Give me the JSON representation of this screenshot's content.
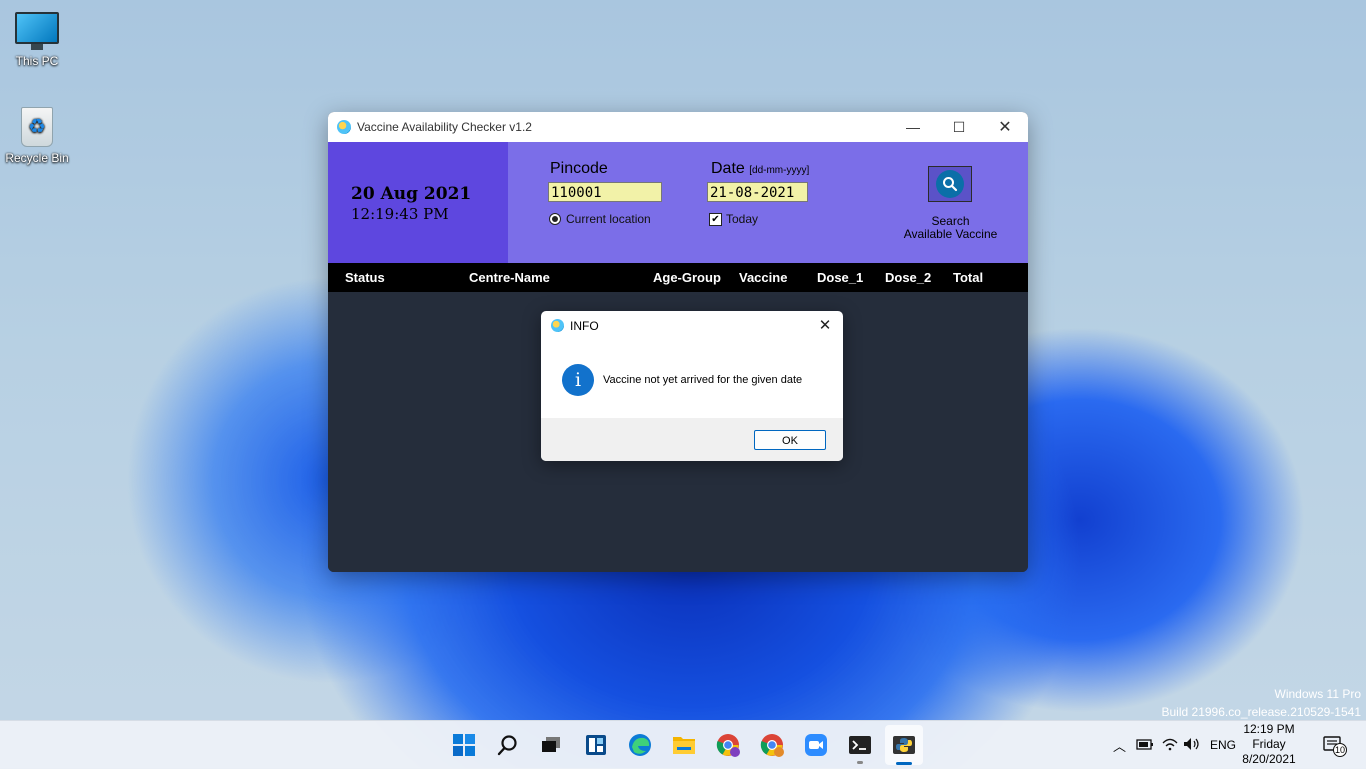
{
  "desktop": {
    "icons": [
      {
        "label": "This PC"
      },
      {
        "label": "Recycle Bin"
      }
    ],
    "watermark": {
      "edition": "Windows 11 Pro",
      "build": "Build 21996.co_release.210529-1541"
    }
  },
  "app": {
    "title": "Vaccine Availability Checker  v1.2",
    "date_display": "20 Aug 2021",
    "time_display": "12:19:43 PM",
    "pincode": {
      "label": "Pincode",
      "value": "110001",
      "option_label": "Current location",
      "option_selected": true
    },
    "date": {
      "label": "Date",
      "format_hint": "[dd-mm-yyyy]",
      "value": "21-08-2021",
      "option_label": "Today",
      "option_checked": true
    },
    "search": {
      "caption_line1": "Search",
      "caption_line2": "Available Vaccine"
    },
    "columns": [
      "Status",
      "Centre-Name",
      "Age-Group",
      "Vaccine",
      "Dose_1",
      "Dose_2",
      "Total"
    ],
    "colors": {
      "header": "#7b6ee8",
      "datebox": "#5e47df",
      "input_bg": "#f2f2a8",
      "table_bg": "#252d3b"
    }
  },
  "dialog": {
    "title": "INFO",
    "message": "Vaccine not yet arrived for the given date",
    "ok_label": "OK",
    "icon": "info-icon"
  },
  "taskbar": {
    "apps": [
      "start",
      "search",
      "task-view",
      "widgets",
      "edge",
      "file-explorer",
      "chrome-profile-1",
      "chrome-profile-2",
      "zoom",
      "terminal",
      "python"
    ],
    "tray": {
      "language": "ENG",
      "time": "12:19 PM",
      "day": "Friday",
      "date": "8/20/2021",
      "notification_count": "10"
    }
  }
}
